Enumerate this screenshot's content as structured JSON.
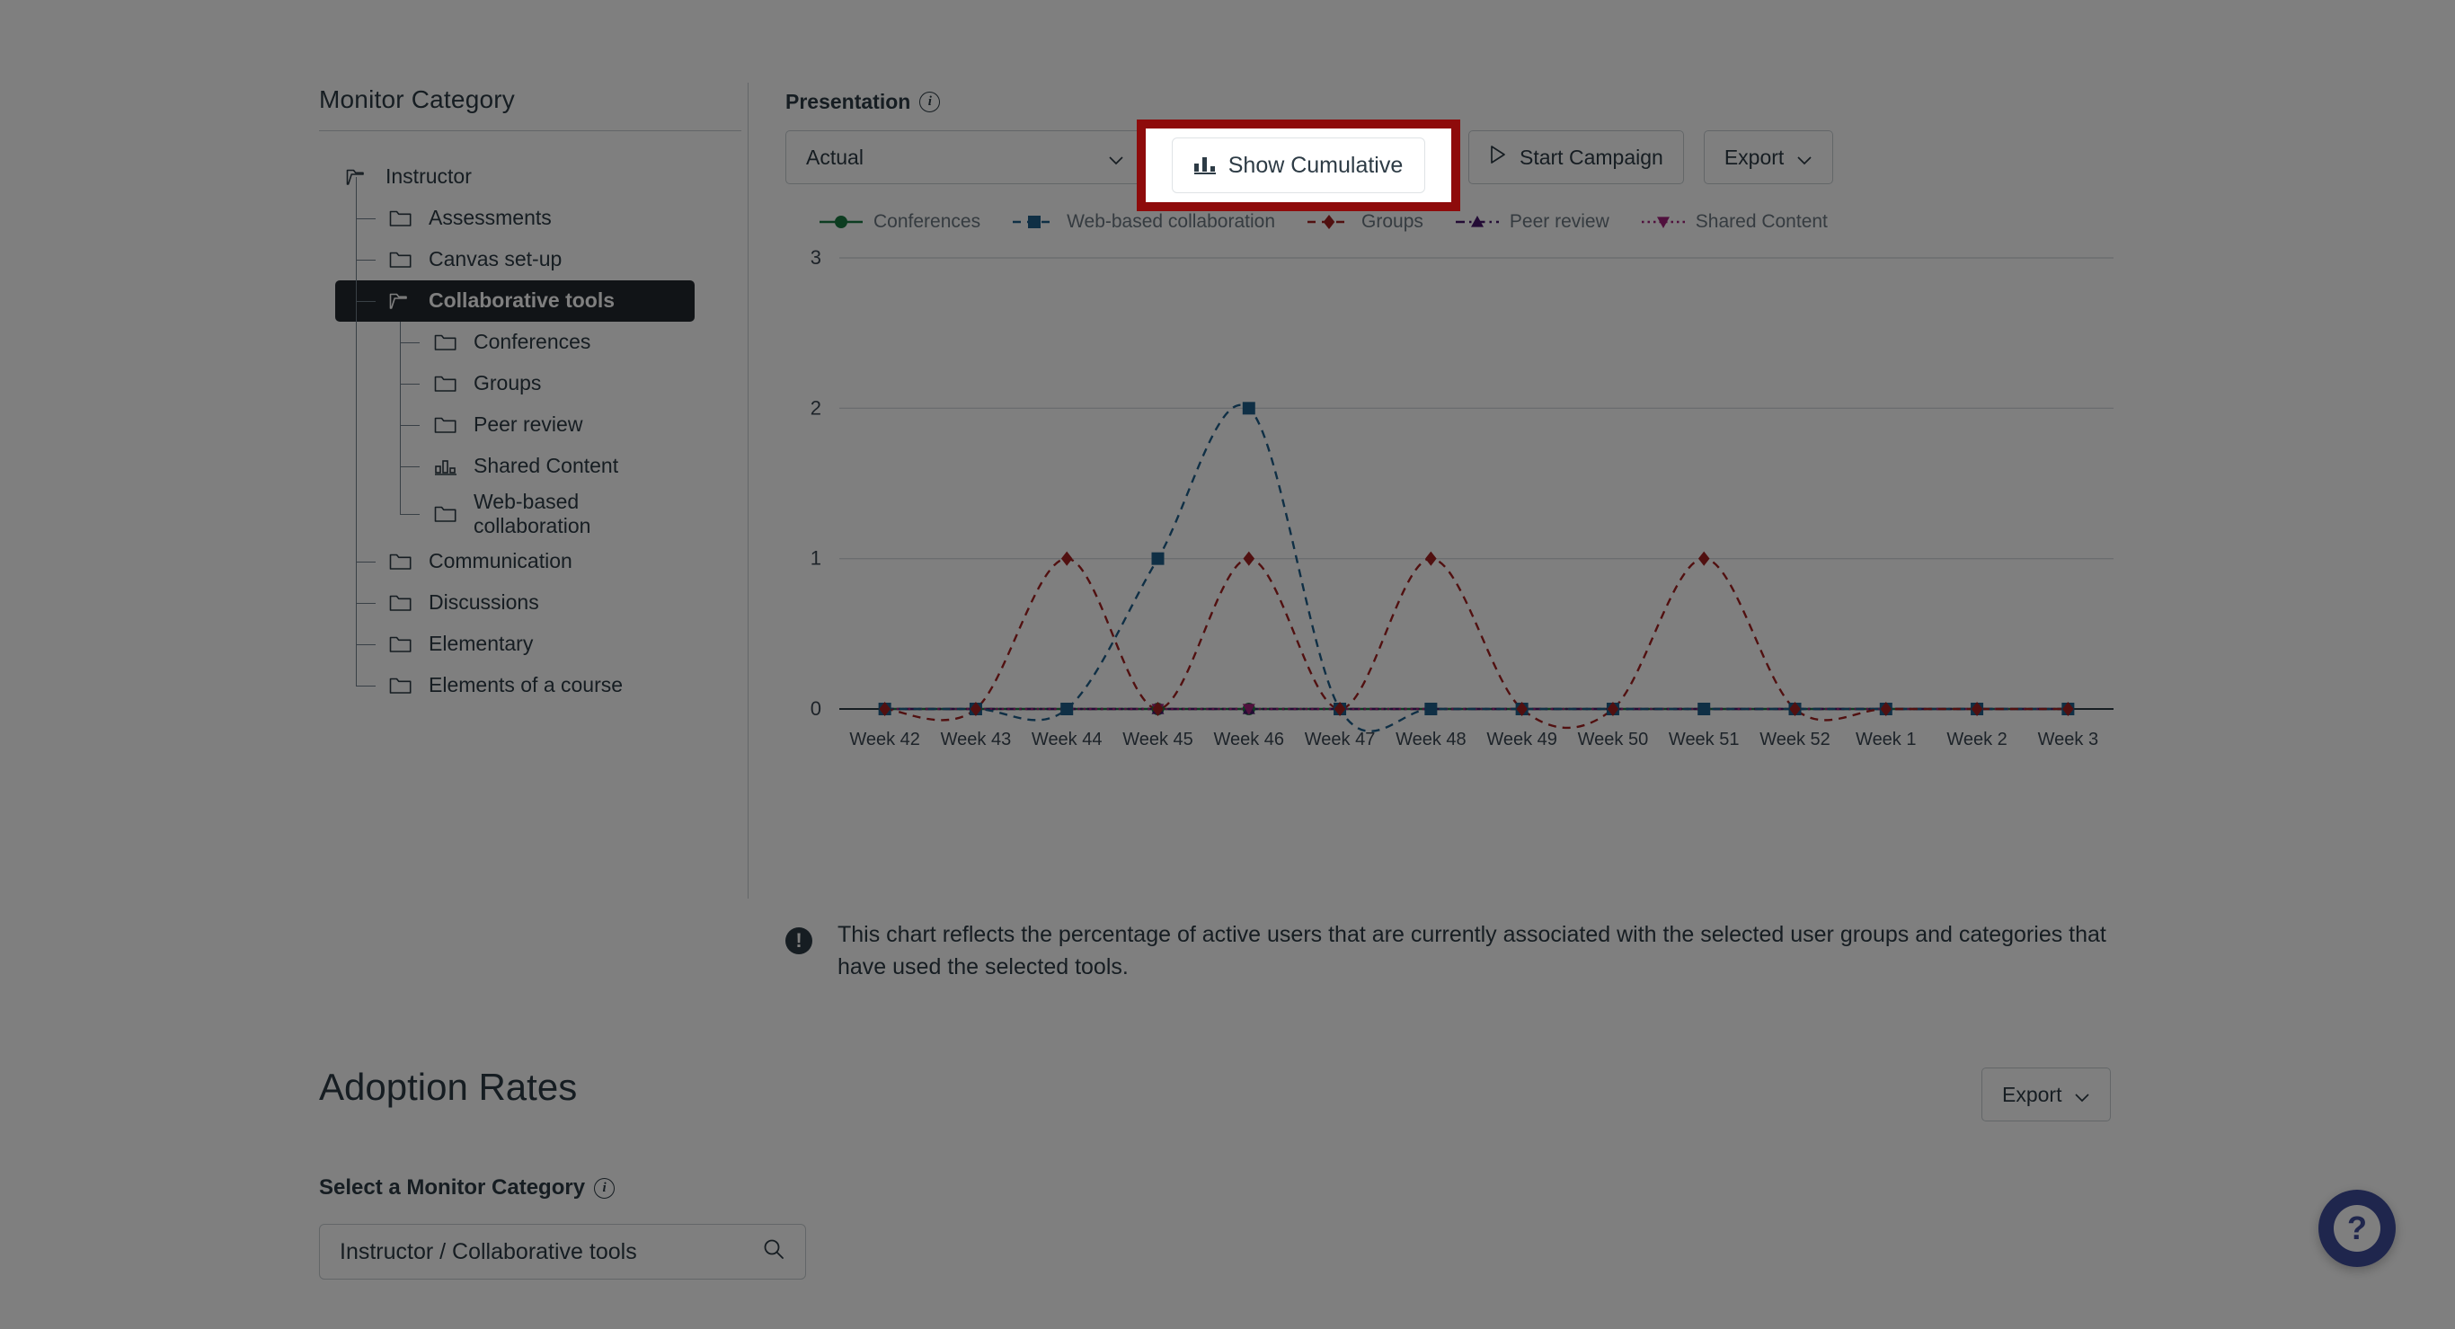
{
  "left_panel": {
    "title": "Monitor Category",
    "tree": [
      {
        "label": "Instructor",
        "depth": 0,
        "icon": "folder-open-icon",
        "selected": false
      },
      {
        "label": "Assessments",
        "depth": 1,
        "icon": "folder-icon",
        "selected": false
      },
      {
        "label": "Canvas set-up",
        "depth": 1,
        "icon": "folder-icon",
        "selected": false
      },
      {
        "label": "Collaborative tools",
        "depth": 1,
        "icon": "folder-open-icon",
        "selected": true
      },
      {
        "label": "Conferences",
        "depth": 2,
        "icon": "folder-icon",
        "selected": false
      },
      {
        "label": "Groups",
        "depth": 2,
        "icon": "folder-icon",
        "selected": false
      },
      {
        "label": "Peer review",
        "depth": 2,
        "icon": "folder-icon",
        "selected": false
      },
      {
        "label": "Shared Content",
        "depth": 2,
        "icon": "bar-chart-icon",
        "selected": false
      },
      {
        "label": "Web-based collaboration",
        "depth": 2,
        "icon": "folder-icon",
        "selected": false
      },
      {
        "label": "Communication",
        "depth": 1,
        "icon": "folder-icon",
        "selected": false
      },
      {
        "label": "Discussions",
        "depth": 1,
        "icon": "folder-icon",
        "selected": false
      },
      {
        "label": "Elementary",
        "depth": 1,
        "icon": "folder-icon",
        "selected": false
      },
      {
        "label": "Elements of a course",
        "depth": 1,
        "icon": "folder-icon",
        "selected": false
      }
    ]
  },
  "toolbar": {
    "presentation_label": "Presentation",
    "presentation_value": "Actual",
    "show_cumulative_label": "Show Cumulative",
    "start_campaign_label": "Start Campaign",
    "export_label": "Export",
    "info_glyph": "i"
  },
  "highlight": {
    "border_color": "#8e0b0b",
    "fill_color": "#ffffff"
  },
  "footnote": {
    "icon_glyph": "!",
    "text": "This chart reflects the percentage of active users that are currently associated with the selected user groups and categories that have used the selected tools."
  },
  "adoption": {
    "title": "Adoption Rates",
    "export_label": "Export",
    "select_label": "Select a Monitor Category",
    "search_value": "Instructor / Collaborative tools",
    "search_icon": "search-icon"
  },
  "help": {
    "glyph": "?",
    "color": "#3f4c9b"
  },
  "chart_data": {
    "type": "line",
    "title": "",
    "xlabel": "",
    "ylabel": "",
    "ylim": [
      0,
      3
    ],
    "yticks": [
      0,
      1,
      2,
      3
    ],
    "grid": true,
    "legend_position": "top",
    "categories": [
      "Week 42",
      "Week 43",
      "Week 44",
      "Week 45",
      "Week 46",
      "Week 47",
      "Week 48",
      "Week 49",
      "Week 50",
      "Week 51",
      "Week 52",
      "Week 1",
      "Week 2",
      "Week 3"
    ],
    "series": [
      {
        "name": "Conferences",
        "color": "#1b7a43",
        "marker": "circle",
        "dash": "solid",
        "values": [
          0,
          0,
          0,
          0,
          0,
          0,
          0,
          0,
          0,
          0,
          0,
          0,
          0,
          0
        ]
      },
      {
        "name": "Web-based collaboration",
        "color": "#1f5f8b",
        "marker": "square",
        "dash": "dashed",
        "values": [
          0,
          0,
          0,
          1,
          2,
          0,
          0,
          0,
          0,
          0,
          0,
          0,
          0,
          0
        ]
      },
      {
        "name": "Groups",
        "color": "#a32020",
        "marker": "diamond",
        "dash": "dashed",
        "values": [
          0,
          0,
          1,
          0,
          1,
          0,
          1,
          0,
          0,
          1,
          0,
          0,
          0,
          0
        ]
      },
      {
        "name": "Peer review",
        "color": "#46166b",
        "marker": "triangle-up",
        "dash": "dashdot",
        "values": [
          0,
          0,
          0,
          0,
          0,
          0,
          0,
          0,
          0,
          0,
          0,
          0,
          0,
          0
        ]
      },
      {
        "name": "Shared Content",
        "color": "#a0207a",
        "marker": "triangle-down",
        "dash": "dotted",
        "values": [
          0,
          0,
          0,
          0,
          0,
          0,
          0,
          0,
          0,
          0,
          0,
          0,
          0,
          0
        ]
      }
    ]
  }
}
